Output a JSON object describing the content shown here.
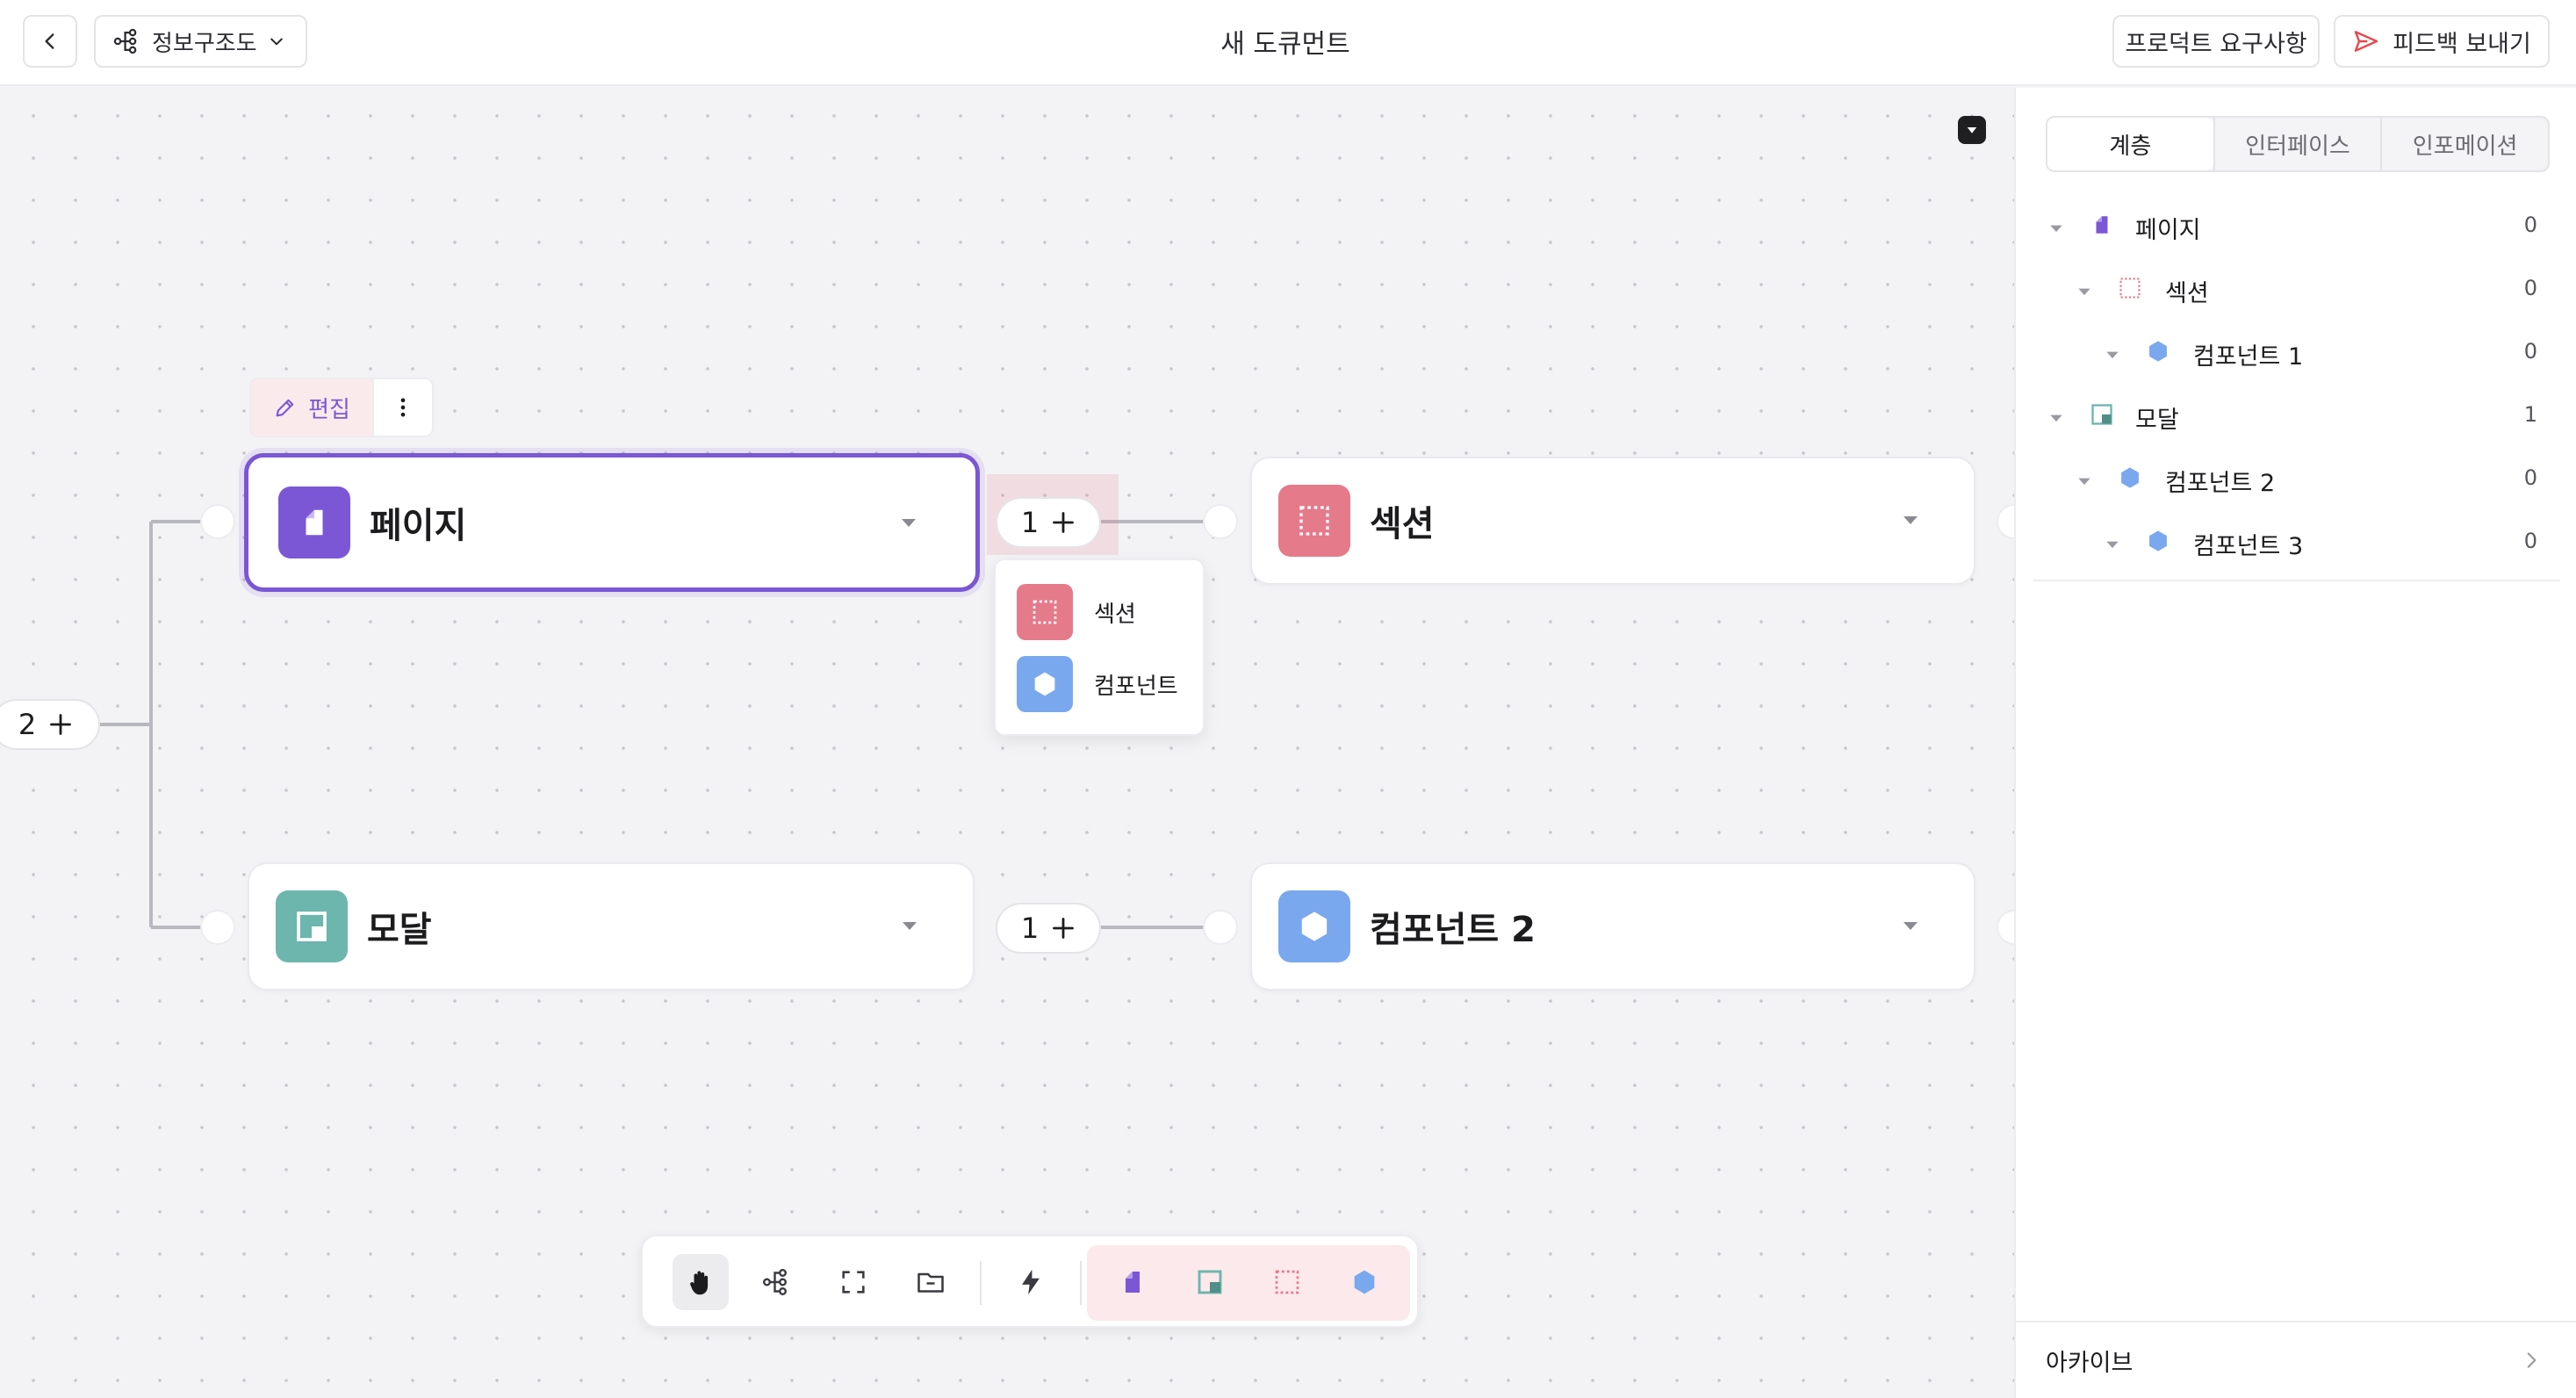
{
  "header": {
    "view_mode_label": "정보구조도",
    "doc_title": "새 도큐먼트",
    "requirements_label": "프로덕트 요구사항",
    "feedback_label": "피드백 보내기"
  },
  "canvas": {
    "edit_label": "편집",
    "root_count": "2",
    "nodes": [
      {
        "label": "페이지",
        "type": "page",
        "selected": true
      },
      {
        "label": "섹션",
        "type": "section"
      },
      {
        "label": "모달",
        "type": "modal"
      },
      {
        "label": "컴포넌트 2",
        "type": "component"
      }
    ],
    "child_counts": [
      "1",
      "1"
    ],
    "add_menu": [
      {
        "label": "섹션",
        "type": "section"
      },
      {
        "label": "컴포넌트",
        "type": "component"
      }
    ]
  },
  "toolbar": {
    "tools": [
      "hand-icon",
      "tree-icon",
      "frame-icon",
      "folder-icon",
      "lightning-icon"
    ],
    "node_types": [
      "page-icon",
      "modal-icon",
      "section-icon",
      "component-icon"
    ]
  },
  "panel": {
    "tabs": [
      {
        "label": "계층",
        "active": true
      },
      {
        "label": "인터페이스",
        "active": false
      },
      {
        "label": "인포메이션",
        "active": false
      }
    ],
    "tree": [
      {
        "label": "페이지",
        "type": "page",
        "depth": 0,
        "count": "0"
      },
      {
        "label": "섹션",
        "type": "section",
        "depth": 1,
        "count": "0"
      },
      {
        "label": "컴포넌트 1",
        "type": "component",
        "depth": 2,
        "count": "0"
      },
      {
        "label": "모달",
        "type": "modal",
        "depth": 0,
        "count": "1"
      },
      {
        "label": "컴포넌트 2",
        "type": "component",
        "depth": 1,
        "count": "0"
      },
      {
        "label": "컴포넌트 3",
        "type": "component",
        "depth": 2,
        "count": "0"
      }
    ],
    "footer_label": "아카이브"
  },
  "colors": {
    "page": "#7b57d6",
    "section": "#e57a8a",
    "modal": "#6db6ae",
    "component": "#7aa8ee",
    "selection": "#7b57d6",
    "feedback_accent": "#e5484d"
  }
}
